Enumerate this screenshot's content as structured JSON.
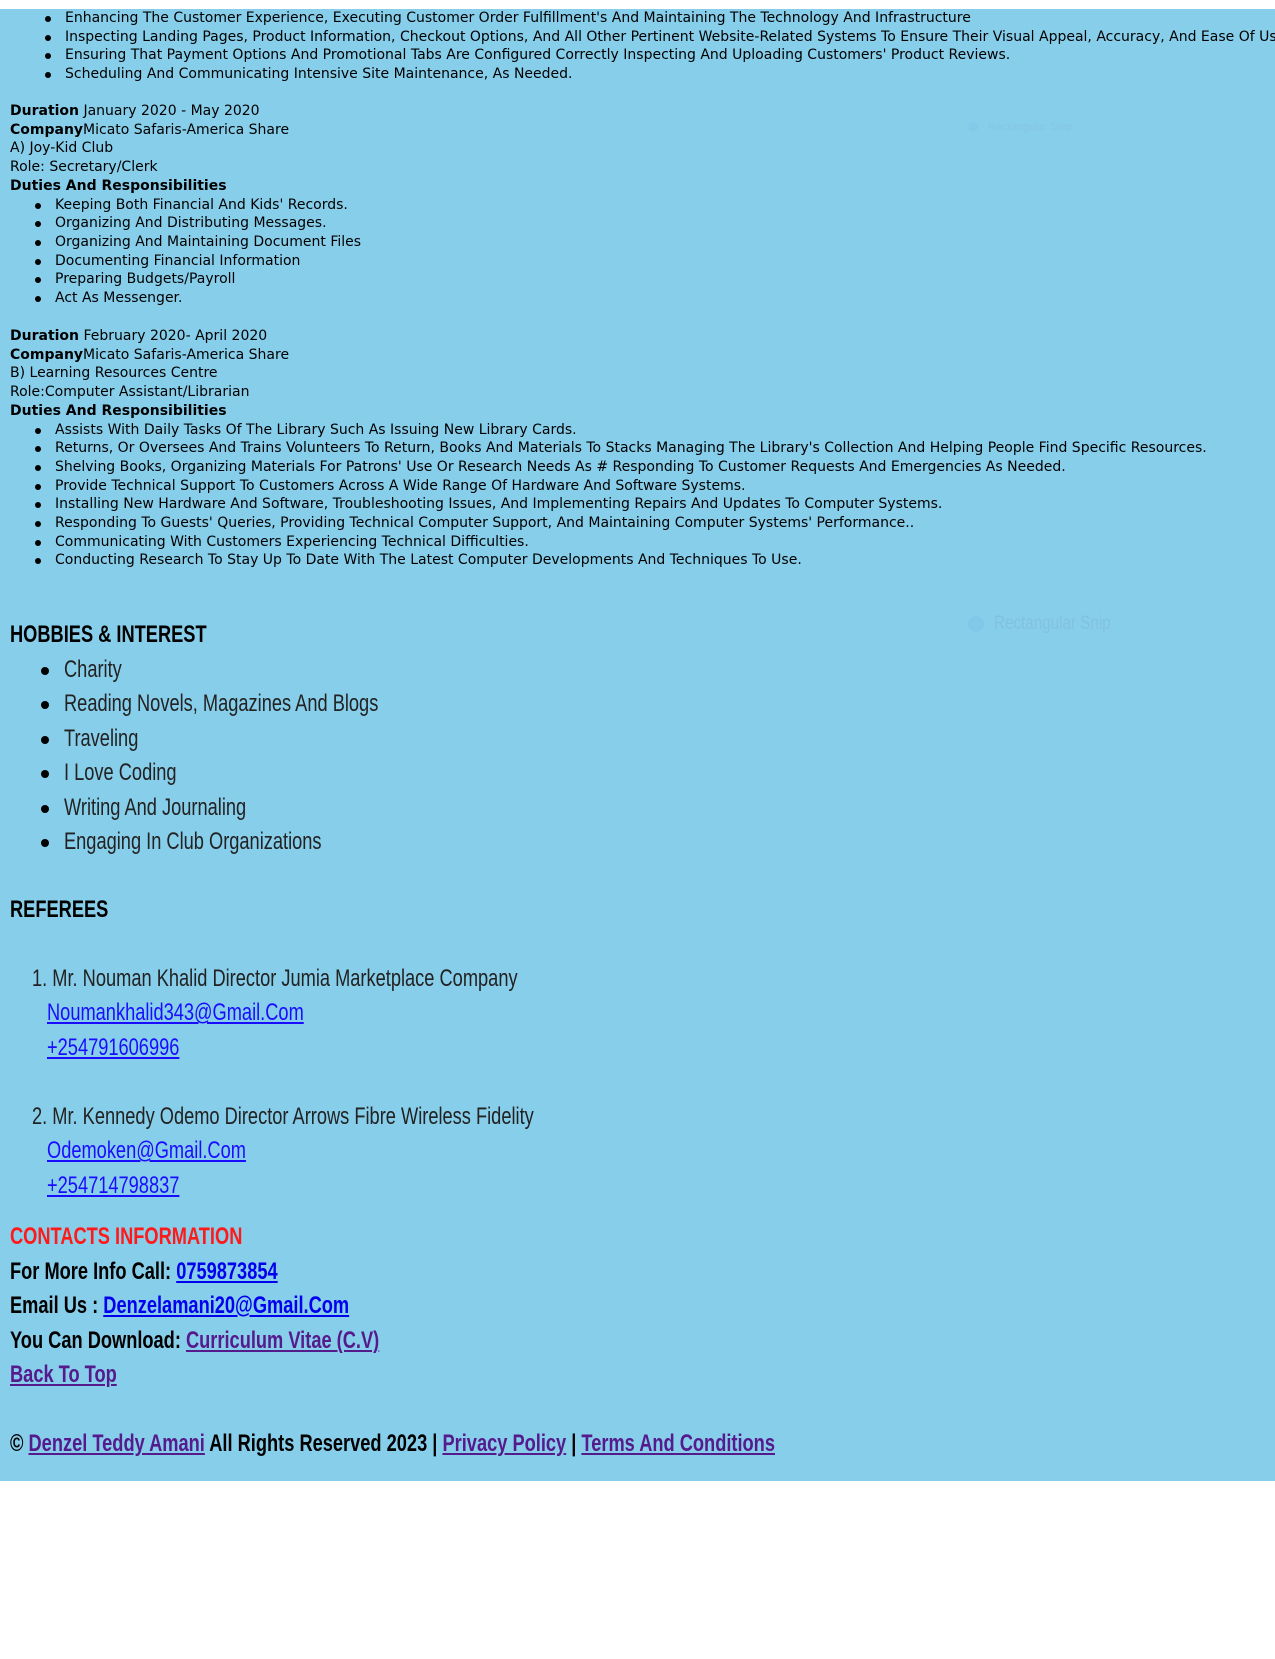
{
  "experience_intro": {
    "duties": [
      "Enhancing The Customer Experience, Executing Customer Order Fulfillment's And Maintaining The Technology And Infrastructure",
      "Inspecting Landing Pages, Product Information, Checkout Options, And All Other Pertinent Website-Related Systems To Ensure Their Visual Appeal, Accuracy, And Ease Of Use",
      "Ensuring That Payment Options And Promotional Tabs Are Configured Correctly Inspecting And Uploading Customers' Product Reviews.",
      "Scheduling And Communicating Intensive Site Maintenance, As Needed."
    ]
  },
  "job_a": {
    "duration_label": "Duration",
    "duration_value": " January 2020 - May 2020",
    "company_label": "Company",
    "company_value": "Micato Safaris-America Share",
    "section": "A) Joy-Kid Club",
    "role": "Role: Secretary/Clerk",
    "duties_heading": "Duties And Responsibilities",
    "duties": [
      "Keeping Both Financial And Kids' Records.",
      "Organizing And Distributing Messages.",
      "Organizing And Maintaining Document Files",
      "Documenting Financial Information",
      "Preparing Budgets/Payroll",
      "Act As Messenger."
    ]
  },
  "job_b": {
    "duration_label": "Duration",
    "duration_value": " February 2020- April 2020",
    "company_label": "Company",
    "company_value": "Micato Safaris-America Share",
    "section": "B) Learning Resources Centre",
    "role": "Role:Computer Assistant/Librarian",
    "duties_heading": "Duties And Responsibilities",
    "duties": [
      "Assists With Daily Tasks Of The Library Such As Issuing New Library Cards.",
      "Returns, Or Oversees And Trains Volunteers To Return, Books And Materials To Stacks Managing The Library's Collection And Helping People Find Specific Resources.",
      "Shelving Books, Organizing Materials For Patrons' Use Or Research Needs As # Responding To Customer Requests And Emergencies As Needed.",
      "Provide Technical Support To Customers Across A Wide Range Of Hardware And Software Systems.",
      "Installing New Hardware And Software, Troubleshooting Issues, And Implementing Repairs And Updates To Computer Systems.",
      "Responding To Guests' Queries, Providing Technical Computer Support, And Maintaining Computer Systems' Performance..",
      "Communicating With Customers Experiencing Technical Difficulties.",
      "Conducting Research To Stay Up To Date With The Latest Computer Developments And Techniques To Use."
    ]
  },
  "overlay": {
    "snip_label": "Rectangular Snip"
  },
  "hobbies": {
    "heading": "HOBBIES & INTEREST",
    "items": [
      "Charity",
      "Reading Novels, Magazines And Blogs",
      "Traveling",
      "I Love Coding",
      "Writing And Journaling",
      "Engaging In Club Organizations"
    ]
  },
  "referees": {
    "heading": "REFEREES",
    "items": [
      {
        "title": "1. Mr. Nouman Khalid Director Jumia Marketplace Company",
        "email": "Noumankhalid343@Gmail.Com",
        "phone": "+254791606996"
      },
      {
        "title": "2. Mr. Kennedy Odemo Director Arrows Fibre Wireless Fidelity",
        "email": "Odemoken@Gmail.Com",
        "phone": "+254714798837"
      }
    ]
  },
  "contacts": {
    "heading": "CONTACTS INFORMATION",
    "heading_color": "#ff0000",
    "call_label": "For More Info Call: ",
    "call_value": "0759873854",
    "email_label": "Email Us : ",
    "email_value": "Denzelamani20@Gmail.Com",
    "download_label": "You Can Download: ",
    "download_value": "Curriculum Vitae (C.V)",
    "back_to_top": "Back To Top"
  },
  "footer": {
    "copyright": "© ",
    "owner": "Denzel Teddy Amani",
    "rights": " All Rights Reserved 2023 | ",
    "privacy": "Privacy Policy",
    "separator": " | ",
    "terms": "Terms And Conditions"
  },
  "colors": {
    "page_background": "#87ceeb",
    "link_blue": "#0000ee",
    "link_visited": "#551a8b"
  }
}
